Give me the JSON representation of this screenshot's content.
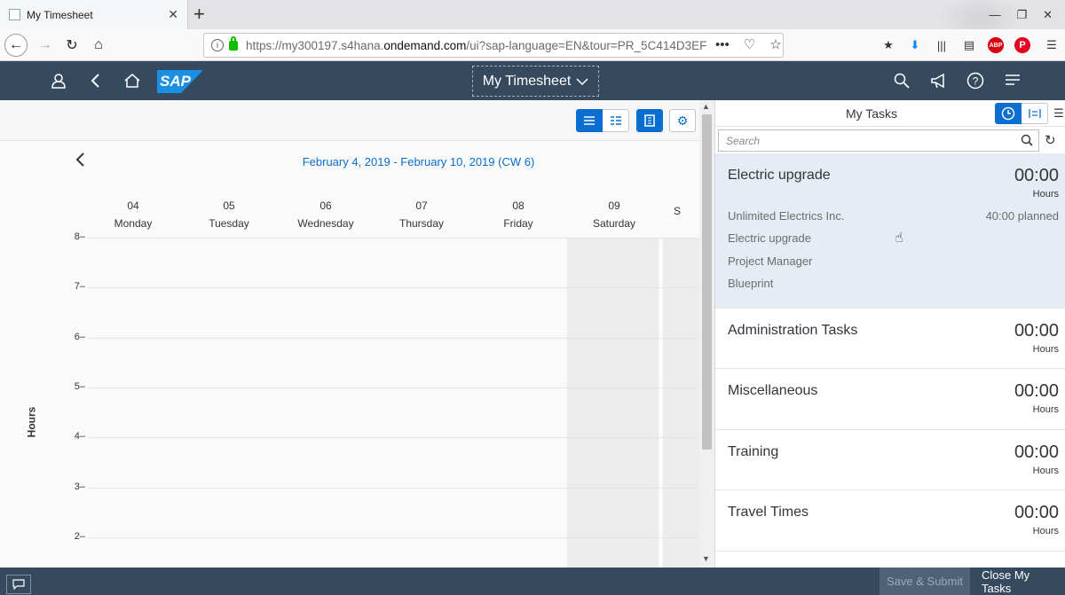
{
  "browser": {
    "tab_title": "My Timesheet",
    "tab_close": "✕",
    "new_tab": "+",
    "url_prefix": "https://my300197.s4hana.",
    "url_host": "ondemand.com",
    "url_suffix": "/ui?sap-language=EN&tour=PR_5C414D3EF",
    "url_more": "•••",
    "ext_abp": "ABP",
    "ext_pin": "P"
  },
  "shell": {
    "logo": "SAP",
    "app_title": "My Timesheet"
  },
  "calendar": {
    "week_range": "February 4, 2019 - February 10, 2019 (CW 6)",
    "days": [
      {
        "num": "04",
        "name": "Monday"
      },
      {
        "num": "05",
        "name": "Tuesday"
      },
      {
        "num": "06",
        "name": "Wednesday"
      },
      {
        "num": "07",
        "name": "Thursday"
      },
      {
        "num": "08",
        "name": "Friday"
      },
      {
        "num": "09",
        "name": "Saturday"
      },
      {
        "num": "",
        "name": "S"
      }
    ],
    "hour_labels": [
      "8",
      "7",
      "6",
      "5",
      "4",
      "3",
      "2"
    ],
    "axis_label": "Hours"
  },
  "tasks": {
    "title": "My Tasks",
    "search_placeholder": "Search",
    "items": [
      {
        "name": "Electric upgrade",
        "time": "00:00",
        "unit": "Hours",
        "customer": "Unlimited Electrics Inc.",
        "project": "Electric upgrade",
        "role": "Project Manager",
        "phase": "Blueprint",
        "planned": "40:00 planned"
      },
      {
        "name": "Administration Tasks",
        "time": "00:00",
        "unit": "Hours"
      },
      {
        "name": "Miscellaneous",
        "time": "00:00",
        "unit": "Hours"
      },
      {
        "name": "Training",
        "time": "00:00",
        "unit": "Hours"
      },
      {
        "name": "Travel Times",
        "time": "00:00",
        "unit": "Hours"
      }
    ]
  },
  "footer": {
    "save_submit": "Save & Submit",
    "close_tasks": "Close My Tasks"
  },
  "colors": {
    "shell": "#354a5f",
    "accent": "#0a6ed1",
    "selected_task": "#e5ecf3"
  }
}
